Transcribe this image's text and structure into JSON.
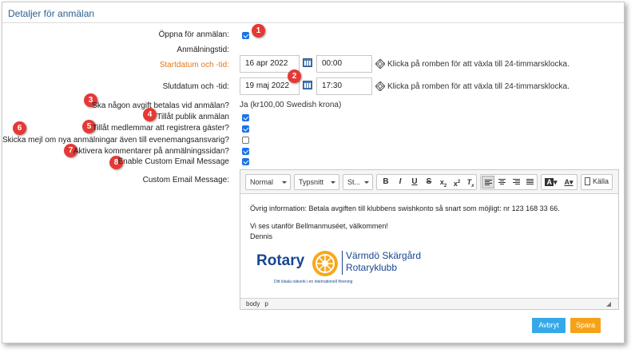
{
  "panel": {
    "title": "Detaljer för anmälan"
  },
  "form": {
    "open_label": "Öppna för anmälan:",
    "period_label": "Anmälningstid:",
    "start_label": "Startdatum och -tid:",
    "start_date": "16 apr 2022",
    "start_time": "00:00",
    "end_label": "Slutdatum och -tid:",
    "end_date": "19 maj 2022",
    "end_time": "17:30",
    "toggle_hint": "Klicka på romben för att växla till 24-timmarsklocka.",
    "fee_label": "Ska någon avgift betalas vid anmälan?",
    "fee_value": "Ja (kr100,00 Swedish krona)",
    "public_label": "Tillåt publik anmälan",
    "guests_label": "Tillåt medlemmar att registrera gäster?",
    "notify_label": "Skicka mejl om nya anmälningar även till evenemangsansvarig?",
    "comments_label": "Aktivera kommentarer på anmälningssidan?",
    "custom_email_label": "Enable Custom Email Message",
    "custom_email_msg_label": "Custom Email Message:"
  },
  "checkboxes": {
    "open": true,
    "public": true,
    "guests": true,
    "notify": false,
    "comments": true,
    "custom_email": true
  },
  "badges": [
    "1",
    "2",
    "3",
    "4",
    "5",
    "6",
    "7",
    "8"
  ],
  "editor": {
    "format_select": "Normal",
    "font_select": "Typsnitt",
    "size_select": "St...",
    "source_label": "Källa",
    "line1": "Övrig information: Betala avgiften till klubbens swishkonto så snart som möjligt: nr 123 168 33 66.",
    "line2": "Vi ses utanför Bellmanmuséet, välkommen!",
    "line3": "Dennis",
    "status_body": "body",
    "status_p": "p"
  },
  "logo": {
    "word": "Rotary",
    "club_line1": "Värmdö Skärgård",
    "club_line2": "Rotaryklubb",
    "tagline": "Ditt lokala nätverk i en internationell förening"
  },
  "buttons": {
    "cancel": "Avbryt",
    "save": "Spara"
  },
  "colors": {
    "accent_blue": "#35a9e8",
    "accent_orange": "#f5a219",
    "title_blue": "#2b5f8f",
    "rotary_blue": "#17458f",
    "rotary_gold": "#f7a81b",
    "badge_red": "#e53935"
  }
}
